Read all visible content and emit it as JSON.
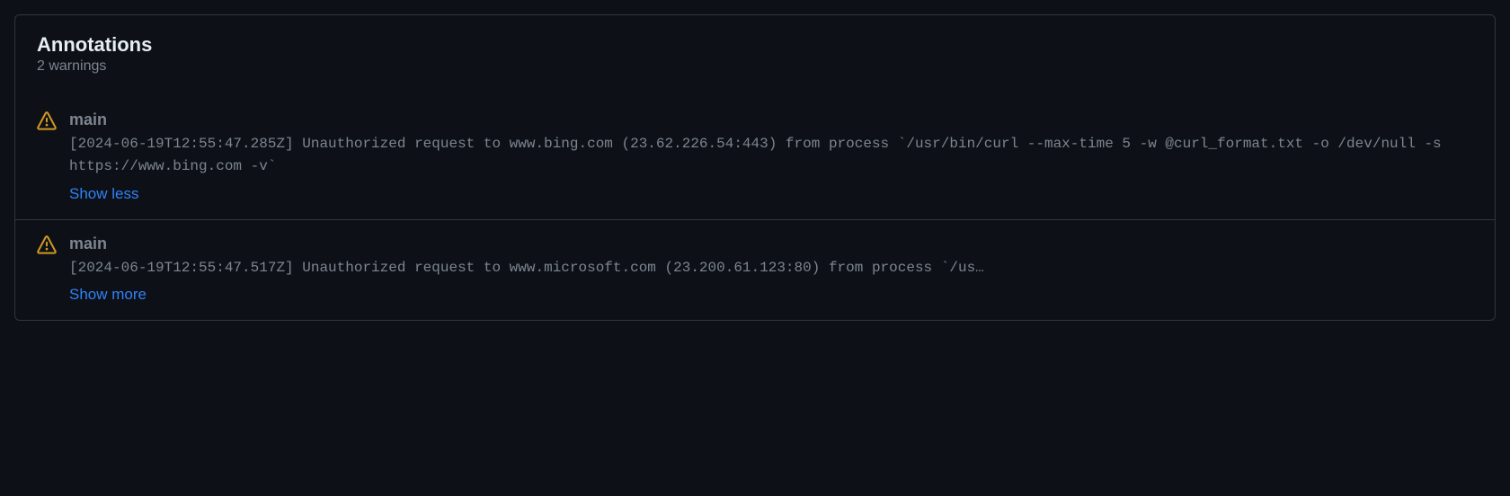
{
  "panel": {
    "title": "Annotations",
    "subtitle": "2 warnings"
  },
  "annotations": [
    {
      "label": "main",
      "message": "[2024-06-19T12:55:47.285Z] Unauthorized request to www.bing.com (23.62.226.54:443) from process `/usr/bin/curl --max-time 5 -w @curl_format.txt -o /dev/null -s https://www.bing.com -v`",
      "toggle": "Show less",
      "expanded": true
    },
    {
      "label": "main",
      "message": "[2024-06-19T12:55:47.517Z] Unauthorized request to www.microsoft.com (23.200.61.123:80) from process `/us…",
      "toggle": "Show more",
      "expanded": false
    }
  ],
  "colors": {
    "warning": "#d29922",
    "link": "#2f81f7",
    "border": "#30363d",
    "bg": "#0d1117"
  }
}
